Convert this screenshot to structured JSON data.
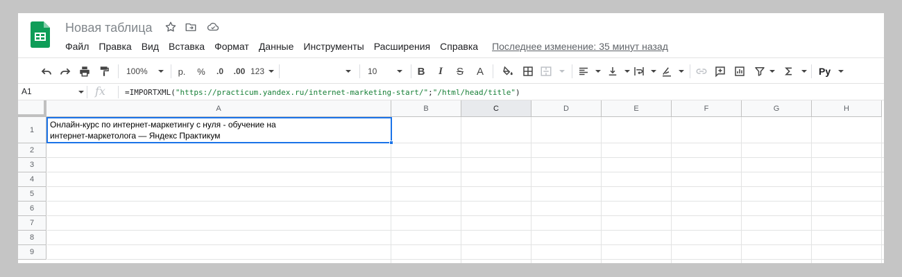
{
  "app": {
    "title": "Новая таблица",
    "accent": "#1a73e8",
    "logo_color": "#0f9d58"
  },
  "menu": {
    "items": [
      "Файл",
      "Правка",
      "Вид",
      "Вставка",
      "Формат",
      "Данные",
      "Инструменты",
      "Расширения",
      "Справка"
    ],
    "last_edit": "Последнее изменение: 35 минут назад"
  },
  "toolbar": {
    "zoom": "100%",
    "currency": "р.",
    "percent": "%",
    "decrease_decimals": ".0",
    "increase_decimals": ".00",
    "more_formats": "123",
    "font_size": "10",
    "bold": "B",
    "italic": "I",
    "strikethrough": "S",
    "text_color": "A",
    "input_tools": "Ру"
  },
  "formula_bar": {
    "name_box": "A1",
    "fx": "fx",
    "formula_prefix": "=IMPORTXML(",
    "formula_arg1": "\"https://practicum.yandex.ru/internet-marketing-start/\"",
    "formula_sep": ";",
    "formula_arg2": "\"/html/head/title\"",
    "formula_suffix": ")"
  },
  "grid": {
    "columns": [
      "A",
      "B",
      "C",
      "D",
      "E",
      "F",
      "G",
      "H"
    ],
    "rows": [
      "1",
      "2",
      "3",
      "4",
      "5",
      "6",
      "7",
      "8",
      "9"
    ],
    "active_column": "C",
    "cell_a1_line1": "Онлайн-курс по интернет-маркетингу с нуля - обучение на",
    "cell_a1_line2": "интернет-маркетолога — Яндекс Практикум"
  }
}
